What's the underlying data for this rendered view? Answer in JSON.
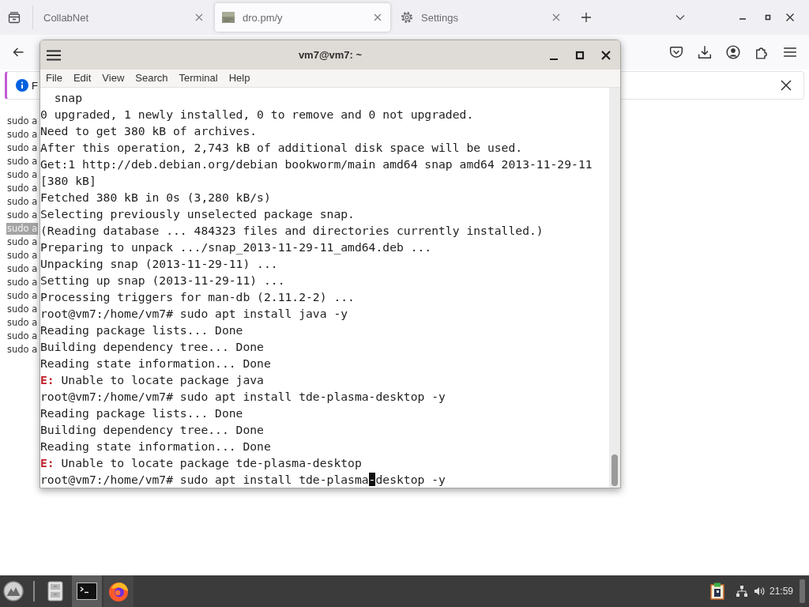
{
  "browser": {
    "tabs": [
      {
        "title": "CollabNet",
        "kind": "plain",
        "selected": false
      },
      {
        "title": "dro.pm/y",
        "kind": "thumbnail",
        "selected": true
      },
      {
        "title": "Settings",
        "kind": "settings",
        "selected": false
      }
    ],
    "notification": {
      "text": "F"
    },
    "page_lines": [
      {
        "text": "sudo a",
        "selected": false
      },
      {
        "text": "sudo a",
        "selected": false
      },
      {
        "text": "sudo a",
        "selected": false
      },
      {
        "text": "sudo a",
        "selected": false
      },
      {
        "text": "sudo a",
        "selected": false
      },
      {
        "text": "sudo a",
        "selected": false
      },
      {
        "text": "sudo a",
        "selected": false
      },
      {
        "text": "sudo a",
        "selected": false
      },
      {
        "text": "sudo a",
        "selected": true
      },
      {
        "text": "sudo a",
        "selected": false
      },
      {
        "text": "sudo a",
        "selected": false
      },
      {
        "text": "sudo a",
        "selected": false
      },
      {
        "text": "sudo a",
        "selected": false
      },
      {
        "text": "sudo a",
        "selected": false
      },
      {
        "text": "sudo a",
        "selected": false
      },
      {
        "text": "sudo a",
        "selected": false
      },
      {
        "text": "sudo a",
        "selected": false
      },
      {
        "text": "sudo a",
        "selected": false
      }
    ]
  },
  "terminal": {
    "title": "vm7@vm7: ~",
    "menu": [
      "File",
      "Edit",
      "View",
      "Search",
      "Terminal",
      "Help"
    ],
    "lines": [
      {
        "kind": "output",
        "text": "  snap"
      },
      {
        "kind": "output",
        "text": "0 upgraded, 1 newly installed, 0 to remove and 0 not upgraded."
      },
      {
        "kind": "output",
        "text": "Need to get 380 kB of archives."
      },
      {
        "kind": "output",
        "text": "After this operation, 2,743 kB of additional disk space will be used."
      },
      {
        "kind": "output",
        "text": "Get:1 http://deb.debian.org/debian bookworm/main amd64 snap amd64 2013-11-29-11"
      },
      {
        "kind": "output",
        "text": "[380 kB]"
      },
      {
        "kind": "output",
        "text": "Fetched 380 kB in 0s (3,280 kB/s)"
      },
      {
        "kind": "output",
        "text": "Selecting previously unselected package snap."
      },
      {
        "kind": "output",
        "text": "(Reading database ... 484323 files and directories currently installed.)"
      },
      {
        "kind": "output",
        "text": "Preparing to unpack .../snap_2013-11-29-11_amd64.deb ..."
      },
      {
        "kind": "output",
        "text": "Unpacking snap (2013-11-29-11) ..."
      },
      {
        "kind": "output",
        "text": "Setting up snap (2013-11-29-11) ..."
      },
      {
        "kind": "output",
        "text": "Processing triggers for man-db (2.11.2-2) ..."
      },
      {
        "kind": "output",
        "text": "root@vm7:/home/vm7# sudo apt install java -y"
      },
      {
        "kind": "output",
        "text": "Reading package lists... Done"
      },
      {
        "kind": "output",
        "text": "Building dependency tree... Done"
      },
      {
        "kind": "output",
        "text": "Reading state information... Done"
      },
      {
        "kind": "error",
        "text": "**E:** Unable to locate package java"
      },
      {
        "kind": "output",
        "text": "root@vm7:/home/vm7# sudo apt install tde-plasma-desktop -y"
      },
      {
        "kind": "output",
        "text": "Reading package lists... Done"
      },
      {
        "kind": "output",
        "text": "Building dependency tree... Done"
      },
      {
        "kind": "output",
        "text": "Reading state information... Done"
      },
      {
        "kind": "error",
        "text": "**E:** Unable to locate package tde-plasma-desktop"
      },
      {
        "kind": "input",
        "before": "root@vm7:/home/vm7# sudo apt install tde-plasma",
        "cursor": "-",
        "after": "desktop -y"
      }
    ]
  },
  "taskbar": {
    "apps": [
      {
        "kind": "files",
        "open": false,
        "selected": false
      },
      {
        "kind": "terminal",
        "open": true,
        "selected": true
      },
      {
        "kind": "browser",
        "open": true,
        "selected": false
      }
    ],
    "clock": "21:59"
  }
}
